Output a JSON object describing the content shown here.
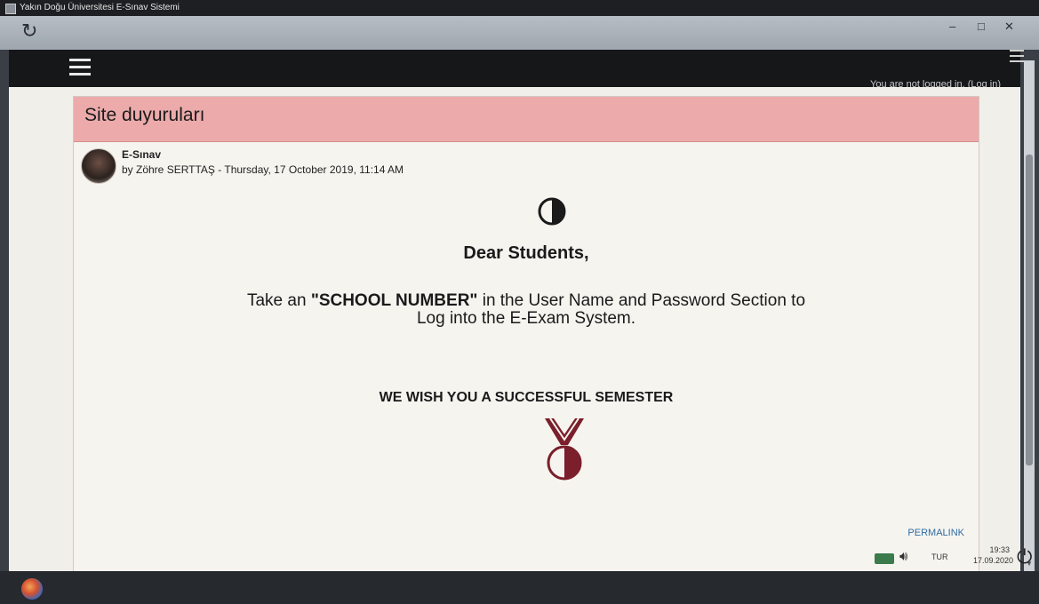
{
  "window": {
    "title": "Yakın Doğu Üniversitesi E-Sınav Sistemi"
  },
  "navbar": {
    "login_status": "You are not logged in. (Log in)"
  },
  "announcements": {
    "header": "Site duyuruları",
    "post": {
      "title": "E-Sınav",
      "byline": "by Zöhre SERTTAŞ - Thursday, 17 October 2019, 11:14 AM",
      "greeting": "Dear Students,",
      "instruction_pre": "Take an ",
      "instruction_bold": "\"SCHOOL NUMBER\"",
      "instruction_post": " in the User Name and Password Section to",
      "instruction_line2": "Log into the E-Exam System.",
      "wish": "WE WISH YOU A SUCCESSFUL SEMESTER",
      "permalink": "PERMALINK"
    }
  },
  "taskbar": {
    "language": "TUR",
    "time": "19:33",
    "date": "17.09.2020"
  },
  "colors": {
    "header_bg": "#ecaaaa",
    "navbar_bg": "#161719",
    "link": "#2e6da4",
    "logo_dark": "#1a1a1a",
    "medal": "#7a1f2b"
  },
  "icons": [
    "reload-icon",
    "hamburger-icon",
    "minimize-icon",
    "maximize-icon",
    "close-icon",
    "university-logo-icon",
    "medal-logo-icon",
    "network-icon",
    "volume-icon",
    "power-icon",
    "start-icon"
  ]
}
